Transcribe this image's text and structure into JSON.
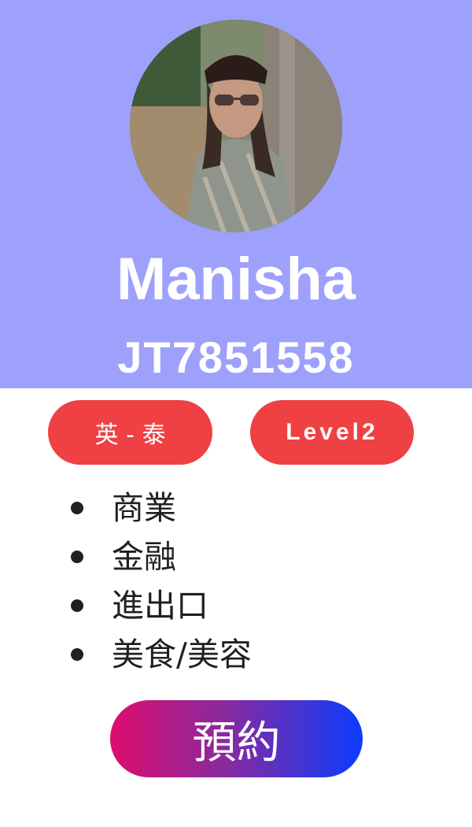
{
  "profile": {
    "avatar_alt": "profile photo",
    "name": "Manisha",
    "id": "JT7851558"
  },
  "badges": {
    "language": "英 - 泰",
    "level": "Level2"
  },
  "topics": [
    "商業",
    "金融",
    "進出口",
    "美食/美容"
  ],
  "actions": {
    "book_label": "預約"
  },
  "colors": {
    "header_bg": "#9da1fb",
    "badge_red": "#ef4043",
    "button_gradient_start": "#dc0d6d",
    "button_gradient_end": "#0a3cff",
    "text_dark": "#231f20"
  }
}
